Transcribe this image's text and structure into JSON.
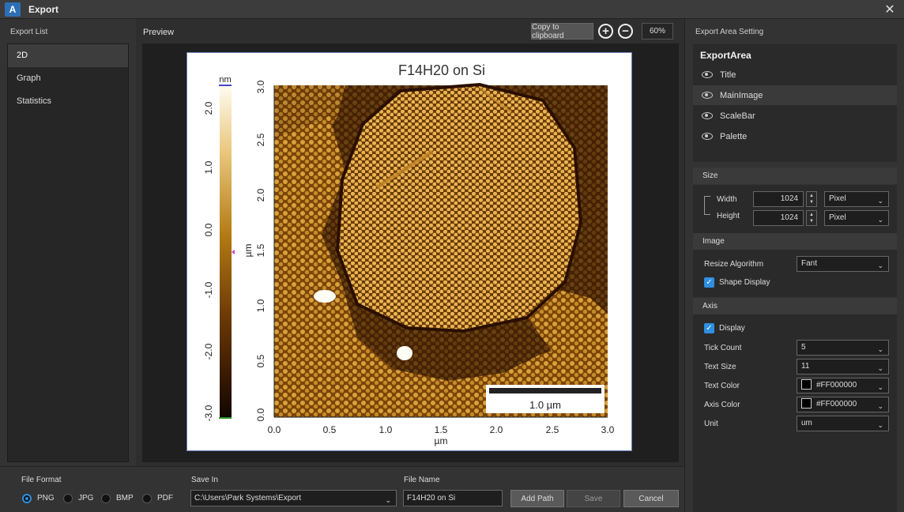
{
  "window": {
    "title": "Export",
    "logo_text": "A"
  },
  "left": {
    "heading": "Export List",
    "items": [
      "2D",
      "Graph",
      "Statistics"
    ]
  },
  "preview": {
    "heading": "Preview",
    "copy_label": "Copy to clipboard",
    "zoom_in_glyph": "+",
    "zoom_out_glyph": "−",
    "zoom_value": "60%"
  },
  "figure": {
    "title": "F14H20 on Si",
    "palette_unit": "nm",
    "palette_ticks": [
      "2.0",
      "1.0",
      "0.0",
      "-1.0",
      "-2.0",
      "-3.0"
    ],
    "y_label": "µm",
    "y_ticks": [
      "0.0",
      "0.5",
      "1.0",
      "1.5",
      "2.0",
      "2.5",
      "3.0"
    ],
    "x_label": "µm",
    "x_ticks": [
      "0.0",
      "0.5",
      "1.0",
      "1.5",
      "2.0",
      "2.5",
      "3.0"
    ],
    "scalebar_label": "1.0 µm",
    "colors": {
      "dark": "#2a0f00",
      "mid": "#8a5200",
      "bright": "#e2b04a",
      "highlight": "#fff3d0",
      "outline": "#6a7fb8"
    }
  },
  "right": {
    "heading": "Export Area  Setting",
    "area_title": "ExportArea",
    "layers": [
      {
        "label": "Title",
        "icon": "eye-icon"
      },
      {
        "label": "MainImage",
        "icon": "eye-icon"
      },
      {
        "label": "ScaleBar",
        "icon": "eye-icon"
      },
      {
        "label": "Palette",
        "icon": "eye-icon"
      }
    ],
    "size": {
      "heading": "Size",
      "width_label": "Width",
      "width_value": "1024",
      "width_unit": "Pixel",
      "height_label": "Height",
      "height_value": "1024",
      "height_unit": "Pixel"
    },
    "image": {
      "heading": "Image",
      "resize_label": "Resize Algorithm",
      "resize_value": "Fant",
      "shape_display_label": "Shape Display"
    },
    "axis": {
      "heading": "Axis",
      "display_label": "Display",
      "tick_count_label": "Tick Count",
      "tick_count_value": "5",
      "text_size_label": "Text Size",
      "text_size_value": "11",
      "text_color_label": "Text Color",
      "text_color_value": "#FF000000",
      "axis_color_label": "Axis Color",
      "axis_color_value": "#FF000000",
      "unit_label": "Unit",
      "unit_value": "um"
    }
  },
  "bottom": {
    "file_format_label": "File Format",
    "formats": [
      "PNG",
      "JPG",
      "BMP",
      "PDF"
    ],
    "save_in_label": "Save In",
    "save_in_value": "C:\\Users\\Park Systems\\Export",
    "file_name_label": "File Name",
    "file_name_value": "F14H20 on Si",
    "add_path_label": "Add Path",
    "save_label": "Save",
    "cancel_label": "Cancel"
  }
}
